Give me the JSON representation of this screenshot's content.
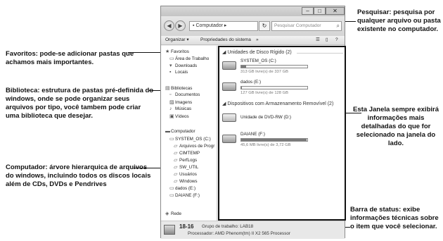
{
  "annotations": {
    "favoritos": "Favoritos: pode-se adicionar pastas que achamos mais importantes.",
    "biblioteca": "Biblioteca: estrutura de pastas pré-definida do windows, onde se pode organizar seus arquivos por tipo, você tambem pode criar uma biblioteca que desejar.",
    "computador": "Computador: árvore hierarquica de arquivos do windows, incluindo todos os discos locais além de CDs, DVDs e Pendrives",
    "pesquisar": "Pesquisar: pesquisa por qualquer arquivo ou pasta existente no computador.",
    "janela": "Esta Janela sempre exibirá informações mais detalhadas do que for selecionado na janela do lado.",
    "status": "Barra de status: exibe informações técnicas sobre o item que você selecionar."
  },
  "window": {
    "address": "Computador ▸",
    "search_placeholder": "Pesquisar Computador",
    "toolbar": {
      "organize": "Organizar ▾",
      "properties": "Propriedades do sistema",
      "more": "»"
    },
    "nav": {
      "favorites": {
        "label": "Favoritos",
        "icon": "star-icon"
      },
      "favorite_items": [
        {
          "label": "Área de Trabalho",
          "icon": "desktop-icon"
        },
        {
          "label": "Downloads",
          "icon": "downloads-icon"
        },
        {
          "label": "Locais",
          "icon": "places-icon"
        }
      ],
      "libraries": {
        "label": "Bibliotecas",
        "icon": "library-icon"
      },
      "library_items": [
        {
          "label": "Documentos",
          "icon": "document-icon"
        },
        {
          "label": "Imagens",
          "icon": "image-icon"
        },
        {
          "label": "Músicas",
          "icon": "music-icon"
        },
        {
          "label": "Vídeos",
          "icon": "video-icon"
        }
      ],
      "computer": {
        "label": "Computador",
        "icon": "computer-icon"
      },
      "computer_items": [
        {
          "label": "SYSTEM_OS (C:)",
          "icon": "drive-icon"
        },
        {
          "label": "Arquivos de Progr",
          "icon": "folder-icon"
        },
        {
          "label": "CIMTEMP",
          "icon": "folder-icon"
        },
        {
          "label": "PerfLogs",
          "icon": "folder-icon"
        },
        {
          "label": "SW_UTIL",
          "icon": "folder-icon"
        },
        {
          "label": "Usuários",
          "icon": "folder-icon"
        },
        {
          "label": "Windows",
          "icon": "folder-icon"
        },
        {
          "label": "dados (E:)",
          "icon": "drive-icon"
        },
        {
          "label": "DAIANE (F:)",
          "icon": "usb-drive-icon"
        }
      ],
      "network": {
        "label": "Rede",
        "icon": "network-icon"
      }
    },
    "content": {
      "group_hdd": "Unidades de Disco Rígido (2)",
      "group_removable": "Dispositivos com Armazenamento Removível (2)",
      "drives": [
        {
          "name": "SYSTEM_OS (C:)",
          "free": "313 GB livre(s) de 337 GB",
          "used_fraction": 0.07
        },
        {
          "name": "dados (E:)",
          "free": "127 GB livre(s) de 128 GB",
          "used_fraction": 0.01
        }
      ],
      "removable": [
        {
          "name": "Unidade de DVD-RW (D:)"
        },
        {
          "name": "DAIANE (F:)",
          "free": "45,6 MB livre(s) de 3,72 GB",
          "used_fraction": 0.99
        }
      ]
    },
    "status": {
      "name": "18-16",
      "workgroup": "Grupo de trabalho: LAB18",
      "processor": "Processador: AMD Phenom(tm) II X2 565 Processor"
    }
  }
}
